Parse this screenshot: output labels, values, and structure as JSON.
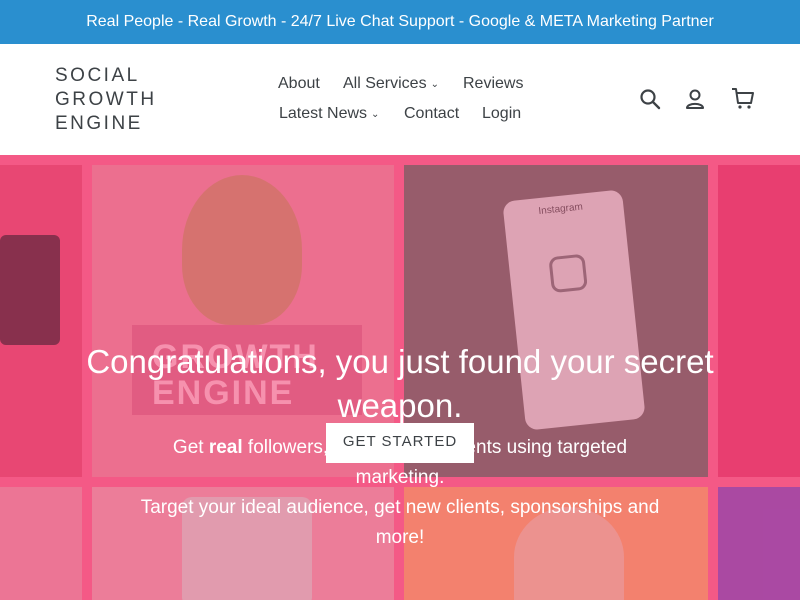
{
  "announcement": {
    "text": "Real People - Real Growth - 24/7 Live Chat Support - Google & META Marketing Partner"
  },
  "header": {
    "logo_lines": [
      "SOCIAL",
      "GROWTH",
      "ENGINE"
    ],
    "nav": {
      "about": "About",
      "all_services": "All Services",
      "reviews": "Reviews",
      "latest_news": "Latest News",
      "contact": "Contact",
      "login": "Login"
    },
    "icons": [
      "search-icon",
      "account-icon",
      "cart-icon"
    ]
  },
  "hero": {
    "title": "Congratulations, you just found your secret weapon.",
    "subtitle_prefix": "Get ",
    "subtitle_bold": "real",
    "subtitle_suffix": " followers, likes and comments using targeted marketing.",
    "subtitle_line2": "Target your ideal audience, get new clients, sponsorships and more!",
    "cta_label": "GET STARTED",
    "image_texts": {
      "growth_engine": "GROWTH ENGINE",
      "instagram": "Instagram"
    }
  },
  "colors": {
    "announcement_bg": "#2a8fcf",
    "hero_overlay": "#f53c78",
    "text_dark": "#3d4246"
  }
}
